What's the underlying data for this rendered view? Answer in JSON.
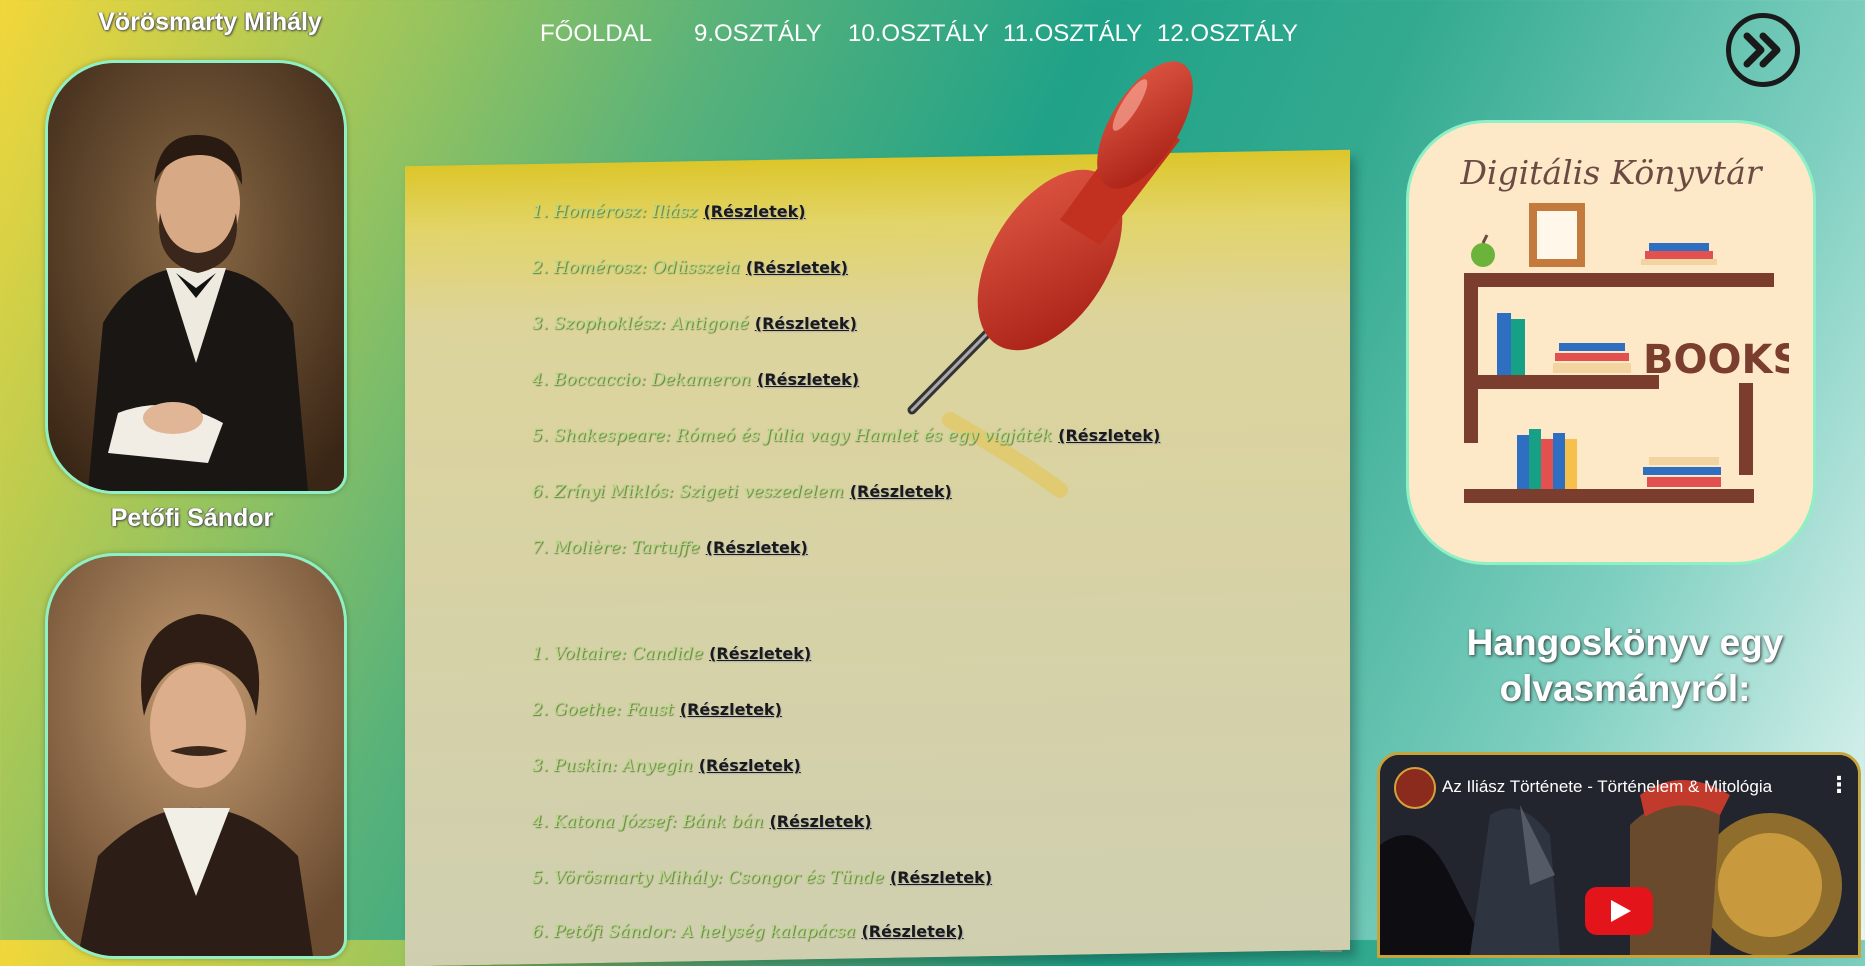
{
  "portraits": {
    "first_name": "Vörösmarty Mihály",
    "second_name": "Petőfi Sándor"
  },
  "nav": {
    "items": [
      "FŐOLDAL",
      "9.OSZTÁLY",
      "10.OSZTÁLY",
      "11.OSZTÁLY",
      "12.OSZTÁLY"
    ],
    "next_icon": "double-chevron-right-icon"
  },
  "list1": [
    {
      "text": "1. Homérosz: Iliász",
      "link": "(Részletek)"
    },
    {
      "text": "2. Homérosz: Odüsszeia",
      "link": "(Részletek)"
    },
    {
      "text": "3. Szophoklész: Antigoné",
      "link": "(Részletek)"
    },
    {
      "text": "4. Boccaccio: Dekameron",
      "link": "(Részletek)"
    },
    {
      "text": "5. Shakespeare: Rómeó és Júlia vagy Hamlet és egy vígjáték",
      "link": "(Részletek)"
    },
    {
      "text": "6. Zrínyi Miklós: Szigeti veszedelem",
      "link": "(Részletek)"
    },
    {
      "text": "7. Molière: Tartuffe",
      "link": "(Részletek)"
    }
  ],
  "list2": [
    {
      "text": "1. Voltaire: Candide",
      "link": "(Részletek)"
    },
    {
      "text": "2. Goethe: Faust",
      "link": "(Részletek)"
    },
    {
      "text": "3. Puskin: Anyegin",
      "link": "(Részletek)"
    },
    {
      "text": "4. Katona József: Bánk bán",
      "link": "(Részletek)"
    },
    {
      "text": "5. Vörösmarty Mihály: Csongor és Tünde",
      "link": "(Részletek)"
    },
    {
      "text": "6. Petőfi Sándor: A helység kalapácsa",
      "link": "(Részletek)"
    }
  ],
  "library": {
    "title": "Digitális Könyvtár",
    "books_label": "BOOKS"
  },
  "audiobook": {
    "heading_line1": "Hangoskönyv egy",
    "heading_line2": "olvasmányról:",
    "video_title": "Az Iliász Története - Történelem & Mitológia",
    "menu_glyph": "⋮"
  },
  "colors": {
    "link": "#1a1a1a",
    "list_text": "#b8d987",
    "frame_border": "#8ef0c4",
    "play_button": "#e3151b"
  }
}
